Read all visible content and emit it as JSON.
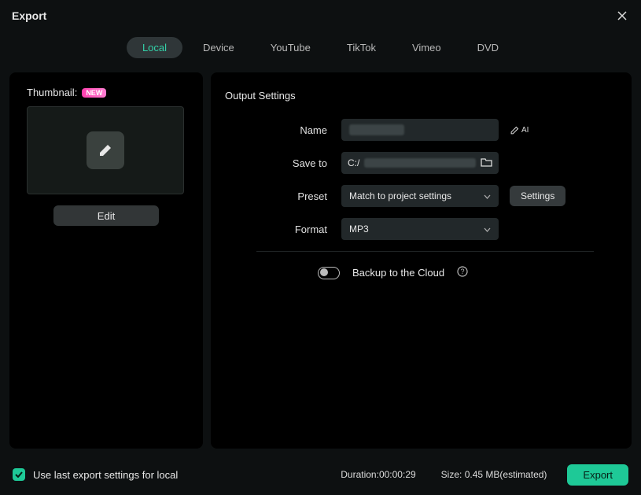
{
  "window": {
    "title": "Export"
  },
  "tabs": [
    {
      "label": "Local",
      "active": true
    },
    {
      "label": "Device"
    },
    {
      "label": "YouTube"
    },
    {
      "label": "TikTok"
    },
    {
      "label": "Vimeo"
    },
    {
      "label": "DVD"
    }
  ],
  "thumbnail": {
    "label": "Thumbnail:",
    "badge": "NEW",
    "edit_label": "Edit"
  },
  "output": {
    "section_title": "Output Settings",
    "name_label": "Name",
    "name_value": "",
    "ai_label": "AI",
    "saveto_label": "Save to",
    "saveto_value": "C:/",
    "preset_label": "Preset",
    "preset_value": "Match to project settings",
    "settings_label": "Settings",
    "format_label": "Format",
    "format_value": "MP3",
    "backup_label": "Backup to the Cloud"
  },
  "footer": {
    "use_last_label": "Use last export settings for local",
    "use_last_checked": true,
    "duration_label": "Duration:",
    "duration_value": "00:00:29",
    "size_label": "Size:",
    "size_value": "0.45 MB(estimated)",
    "export_label": "Export"
  }
}
